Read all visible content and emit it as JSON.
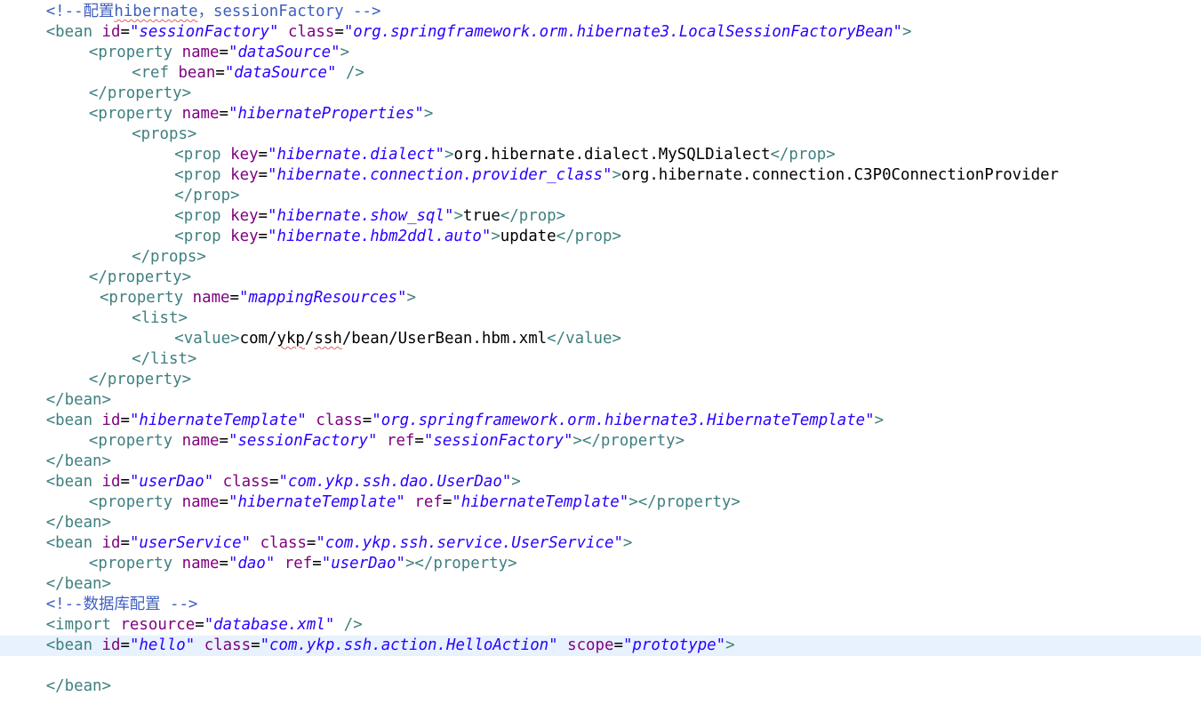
{
  "editor": {
    "current_line_index": 31,
    "colors": {
      "tag": "#3f7f7f",
      "attribute": "#7f007f",
      "string": "#2a00ff",
      "text": "#000000",
      "comment": "#3f5fbf",
      "current_line_background": "#e8f2fe"
    },
    "lines": [
      {
        "indent": 4,
        "tokens": [
          {
            "t": "comment",
            "v": "<!--配置"
          },
          {
            "t": "comment",
            "v": "hibernate",
            "squiggle": true
          },
          {
            "t": "comment",
            "v": "，sessionFactory -->"
          }
        ]
      },
      {
        "indent": 4,
        "tokens": [
          {
            "t": "tag",
            "v": "<bean "
          },
          {
            "t": "attr",
            "v": "id"
          },
          {
            "t": "eq",
            "v": "="
          },
          {
            "t": "str",
            "v": "\"sessionFactory\""
          },
          {
            "t": "tag",
            "v": " "
          },
          {
            "t": "attr",
            "v": "class"
          },
          {
            "t": "eq",
            "v": "="
          },
          {
            "t": "str",
            "v": "\"org.springframework.orm.hibernate3.LocalSessionFactoryBean\""
          },
          {
            "t": "tag",
            "v": ">"
          }
        ]
      },
      {
        "indent": 8,
        "tokens": [
          {
            "t": "tag",
            "v": "<property "
          },
          {
            "t": "attr",
            "v": "name"
          },
          {
            "t": "eq",
            "v": "="
          },
          {
            "t": "str",
            "v": "\"dataSource\""
          },
          {
            "t": "tag",
            "v": ">"
          }
        ]
      },
      {
        "indent": 12,
        "tokens": [
          {
            "t": "tag",
            "v": "<ref "
          },
          {
            "t": "attr",
            "v": "bean"
          },
          {
            "t": "eq",
            "v": "="
          },
          {
            "t": "str",
            "v": "\"dataSource\""
          },
          {
            "t": "tag",
            "v": " />"
          }
        ]
      },
      {
        "indent": 8,
        "tokens": [
          {
            "t": "tag",
            "v": "</property>"
          }
        ]
      },
      {
        "indent": 8,
        "tokens": [
          {
            "t": "tag",
            "v": "<property "
          },
          {
            "t": "attr",
            "v": "name"
          },
          {
            "t": "eq",
            "v": "="
          },
          {
            "t": "str",
            "v": "\"hibernateProperties\""
          },
          {
            "t": "tag",
            "v": ">"
          }
        ]
      },
      {
        "indent": 12,
        "tokens": [
          {
            "t": "tag",
            "v": "<props>"
          }
        ]
      },
      {
        "indent": 16,
        "tokens": [
          {
            "t": "tag",
            "v": "<prop "
          },
          {
            "t": "attr",
            "v": "key"
          },
          {
            "t": "eq",
            "v": "="
          },
          {
            "t": "str",
            "v": "\"hibernate.dialect\""
          },
          {
            "t": "tag",
            "v": ">"
          },
          {
            "t": "text",
            "v": "org.hibernate.dialect.MySQLDialect"
          },
          {
            "t": "tag",
            "v": "</prop>"
          }
        ]
      },
      {
        "indent": 16,
        "tokens": [
          {
            "t": "tag",
            "v": "<prop "
          },
          {
            "t": "attr",
            "v": "key"
          },
          {
            "t": "eq",
            "v": "="
          },
          {
            "t": "str",
            "v": "\"hibernate.connection.provider_class\""
          },
          {
            "t": "tag",
            "v": ">"
          },
          {
            "t": "text",
            "v": "org.hibernate.connection.C3P0ConnectionProvider"
          }
        ]
      },
      {
        "indent": 16,
        "tokens": [
          {
            "t": "tag",
            "v": "</prop>"
          }
        ]
      },
      {
        "indent": 16,
        "tokens": [
          {
            "t": "tag",
            "v": "<prop "
          },
          {
            "t": "attr",
            "v": "key"
          },
          {
            "t": "eq",
            "v": "="
          },
          {
            "t": "str",
            "v": "\"hibernate.show_sql\""
          },
          {
            "t": "tag",
            "v": ">"
          },
          {
            "t": "text",
            "v": "true"
          },
          {
            "t": "tag",
            "v": "</prop>"
          }
        ]
      },
      {
        "indent": 16,
        "tokens": [
          {
            "t": "tag",
            "v": "<prop "
          },
          {
            "t": "attr",
            "v": "key"
          },
          {
            "t": "eq",
            "v": "="
          },
          {
            "t": "str",
            "v": "\"hibernate.hbm2ddl.auto\""
          },
          {
            "t": "tag",
            "v": ">"
          },
          {
            "t": "text",
            "v": "update"
          },
          {
            "t": "tag",
            "v": "</prop>"
          }
        ]
      },
      {
        "indent": 12,
        "tokens": [
          {
            "t": "tag",
            "v": "</props>"
          }
        ]
      },
      {
        "indent": 8,
        "tokens": [
          {
            "t": "tag",
            "v": "</property>"
          }
        ]
      },
      {
        "indent": 9,
        "tokens": [
          {
            "t": "tag",
            "v": "<property "
          },
          {
            "t": "attr",
            "v": "name"
          },
          {
            "t": "eq",
            "v": "="
          },
          {
            "t": "str",
            "v": "\"mappingResources\""
          },
          {
            "t": "tag",
            "v": ">"
          }
        ]
      },
      {
        "indent": 12,
        "tokens": [
          {
            "t": "tag",
            "v": "<list>"
          }
        ]
      },
      {
        "indent": 16,
        "tokens": [
          {
            "t": "tag",
            "v": "<value>"
          },
          {
            "t": "text",
            "v": "com/"
          },
          {
            "t": "text",
            "v": "ykp",
            "squiggle": true
          },
          {
            "t": "text",
            "v": "/"
          },
          {
            "t": "text",
            "v": "ssh",
            "squiggle": true
          },
          {
            "t": "text",
            "v": "/bean/UserBean.hbm.xml"
          },
          {
            "t": "tag",
            "v": "</value>"
          }
        ]
      },
      {
        "indent": 12,
        "tokens": [
          {
            "t": "tag",
            "v": "</list>"
          }
        ]
      },
      {
        "indent": 8,
        "tokens": [
          {
            "t": "tag",
            "v": "</property>"
          }
        ]
      },
      {
        "indent": 4,
        "tokens": [
          {
            "t": "tag",
            "v": "</bean>"
          }
        ]
      },
      {
        "indent": 4,
        "tokens": [
          {
            "t": "tag",
            "v": "<bean "
          },
          {
            "t": "attr",
            "v": "id"
          },
          {
            "t": "eq",
            "v": "="
          },
          {
            "t": "str",
            "v": "\"hibernateTemplate\""
          },
          {
            "t": "tag",
            "v": " "
          },
          {
            "t": "attr",
            "v": "class"
          },
          {
            "t": "eq",
            "v": "="
          },
          {
            "t": "str",
            "v": "\"org.springframework.orm.hibernate3.HibernateTemplate\""
          },
          {
            "t": "tag",
            "v": ">"
          }
        ]
      },
      {
        "indent": 8,
        "tokens": [
          {
            "t": "tag",
            "v": "<property "
          },
          {
            "t": "attr",
            "v": "name"
          },
          {
            "t": "eq",
            "v": "="
          },
          {
            "t": "str",
            "v": "\"sessionFactory\""
          },
          {
            "t": "tag",
            "v": " "
          },
          {
            "t": "attr",
            "v": "ref"
          },
          {
            "t": "eq",
            "v": "="
          },
          {
            "t": "str",
            "v": "\"sessionFactory\""
          },
          {
            "t": "tag",
            "v": "></property>"
          }
        ]
      },
      {
        "indent": 4,
        "tokens": [
          {
            "t": "tag",
            "v": "</bean>"
          }
        ]
      },
      {
        "indent": 4,
        "tokens": [
          {
            "t": "tag",
            "v": "<bean "
          },
          {
            "t": "attr",
            "v": "id"
          },
          {
            "t": "eq",
            "v": "="
          },
          {
            "t": "str",
            "v": "\"userDao\""
          },
          {
            "t": "tag",
            "v": " "
          },
          {
            "t": "attr",
            "v": "class"
          },
          {
            "t": "eq",
            "v": "="
          },
          {
            "t": "str",
            "v": "\"com.ykp.ssh.dao.UserDao\""
          },
          {
            "t": "tag",
            "v": ">"
          }
        ]
      },
      {
        "indent": 8,
        "tokens": [
          {
            "t": "tag",
            "v": "<property "
          },
          {
            "t": "attr",
            "v": "name"
          },
          {
            "t": "eq",
            "v": "="
          },
          {
            "t": "str",
            "v": "\"hibernateTemplate\""
          },
          {
            "t": "tag",
            "v": " "
          },
          {
            "t": "attr",
            "v": "ref"
          },
          {
            "t": "eq",
            "v": "="
          },
          {
            "t": "str",
            "v": "\"hibernateTemplate\""
          },
          {
            "t": "tag",
            "v": "></property>"
          }
        ]
      },
      {
        "indent": 4,
        "tokens": [
          {
            "t": "tag",
            "v": "</bean>"
          }
        ]
      },
      {
        "indent": 4,
        "tokens": [
          {
            "t": "tag",
            "v": "<bean "
          },
          {
            "t": "attr",
            "v": "id"
          },
          {
            "t": "eq",
            "v": "="
          },
          {
            "t": "str",
            "v": "\"userService\""
          },
          {
            "t": "tag",
            "v": " "
          },
          {
            "t": "attr",
            "v": "class"
          },
          {
            "t": "eq",
            "v": "="
          },
          {
            "t": "str",
            "v": "\"com.ykp.ssh.service.UserService\""
          },
          {
            "t": "tag",
            "v": ">"
          }
        ]
      },
      {
        "indent": 8,
        "tokens": [
          {
            "t": "tag",
            "v": "<property "
          },
          {
            "t": "attr",
            "v": "name"
          },
          {
            "t": "eq",
            "v": "="
          },
          {
            "t": "str",
            "v": "\"dao\""
          },
          {
            "t": "tag",
            "v": " "
          },
          {
            "t": "attr",
            "v": "ref"
          },
          {
            "t": "eq",
            "v": "="
          },
          {
            "t": "str",
            "v": "\"userDao\""
          },
          {
            "t": "tag",
            "v": "></property>"
          }
        ]
      },
      {
        "indent": 4,
        "tokens": [
          {
            "t": "tag",
            "v": "</bean>"
          }
        ]
      },
      {
        "indent": 4,
        "tokens": [
          {
            "t": "comment",
            "v": "<!--数据库配置 -->"
          }
        ]
      },
      {
        "indent": 4,
        "tokens": [
          {
            "t": "tag",
            "v": "<import "
          },
          {
            "t": "attr",
            "v": "resource"
          },
          {
            "t": "eq",
            "v": "="
          },
          {
            "t": "str",
            "v": "\"database.xml\""
          },
          {
            "t": "tag",
            "v": " />"
          }
        ]
      },
      {
        "indent": 4,
        "tokens": [
          {
            "t": "tag",
            "v": "<bean "
          },
          {
            "t": "attr",
            "v": "id"
          },
          {
            "t": "eq",
            "v": "="
          },
          {
            "t": "str",
            "v": "\"hello\""
          },
          {
            "t": "tag",
            "v": " "
          },
          {
            "t": "attr",
            "v": "class"
          },
          {
            "t": "eq",
            "v": "="
          },
          {
            "t": "str",
            "v": "\"com.ykp.ssh.action.HelloAction\""
          },
          {
            "t": "tag",
            "v": " "
          },
          {
            "t": "attr",
            "v": "scope"
          },
          {
            "t": "eq",
            "v": "="
          },
          {
            "t": "str",
            "v": "\"prototype\""
          },
          {
            "t": "tag",
            "v": ">"
          }
        ]
      },
      {
        "indent": 0,
        "tokens": []
      },
      {
        "indent": 4,
        "tokens": [
          {
            "t": "tag",
            "v": "</bean>"
          }
        ]
      }
    ]
  }
}
